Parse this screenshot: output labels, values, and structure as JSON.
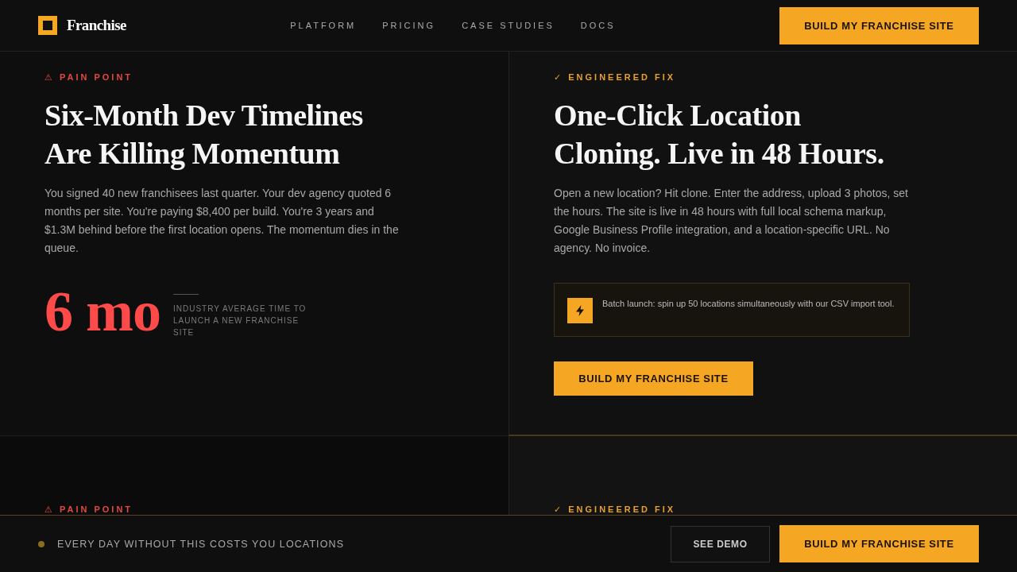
{
  "header": {
    "logo": "Franchise",
    "nav": [
      "PLATFORM",
      "PRICING",
      "CASE STUDIES",
      "DOCS"
    ],
    "cta": "BUILD MY FRANCHISE SITE"
  },
  "rows": [
    {
      "panels": [
        {
          "kind": "pain",
          "label": "⚠ PAIN POINT",
          "heading": "Six-Month Dev Timelines Are Killing Momentum",
          "body": "You signed 40 new franchisees last quarter. Your dev agency quoted 6 months per site. You're paying $8,400 per build. You're 3 years and $1.3M behind before the first location opens. The momentum dies in the queue.",
          "stat": {
            "value": "6 mo",
            "caption": "INDUSTRY AVERAGE TIME TO LAUNCH A NEW FRANCHISE SITE"
          }
        },
        {
          "kind": "fix",
          "label": "✓ ENGINEERED FIX",
          "heading": "One-Click Location Cloning. Live in 48 Hours.",
          "body": "Open a new location? Hit clone. Enter the address, upload 3 photos, set the hours. The site is live in 48 hours with full local schema markup, Google Business Profile integration, and a location-specific URL. No agency. No invoice.",
          "callout": "Batch launch: spin up 50 locations simultaneously with our CSV import tool.",
          "button": "BUILD MY FRANCHISE SITE"
        }
      ]
    },
    {
      "panels": [
        {
          "kind": "pain",
          "label": "⚠ PAIN POINT"
        },
        {
          "kind": "fix",
          "label": "✓ ENGINEERED FIX"
        }
      ]
    }
  ],
  "footer": {
    "message": "EVERY DAY WITHOUT THIS COSTS YOU LOCATIONS",
    "secondary": "SEE DEMO",
    "cta": "BUILD MY FRANCHISE SITE"
  }
}
